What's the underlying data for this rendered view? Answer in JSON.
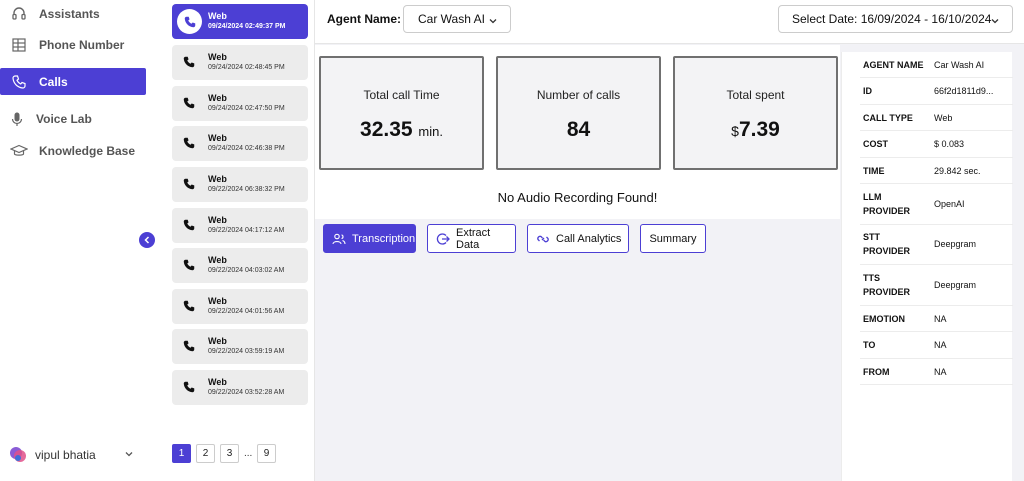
{
  "sidebar": {
    "items": [
      {
        "label": "Assistants",
        "icon": "headset-icon"
      },
      {
        "label": "Phone Number",
        "icon": "grid-icon"
      },
      {
        "label": "Calls",
        "icon": "phone-icon"
      },
      {
        "label": "Voice Lab",
        "icon": "microphone-icon"
      },
      {
        "label": "Knowledge Base",
        "icon": "graduation-cap-icon"
      }
    ],
    "user_name": "vipul bhatia"
  },
  "calls": [
    {
      "type": "Web",
      "time": "09/24/2024 02:49:37 PM"
    },
    {
      "type": "Web",
      "time": "09/24/2024 02:48:45 PM"
    },
    {
      "type": "Web",
      "time": "09/24/2024 02:47:50 PM"
    },
    {
      "type": "Web",
      "time": "09/24/2024 02:46:38 PM"
    },
    {
      "type": "Web",
      "time": "09/22/2024 06:38:32 PM"
    },
    {
      "type": "Web",
      "time": "09/22/2024 04:17:12 AM"
    },
    {
      "type": "Web",
      "time": "09/22/2024 04:03:02 AM"
    },
    {
      "type": "Web",
      "time": "09/22/2024 04:01:56 AM"
    },
    {
      "type": "Web",
      "time": "09/22/2024 03:59:19 AM"
    },
    {
      "type": "Web",
      "time": "09/22/2024 03:52:28 AM"
    }
  ],
  "pager": {
    "pages": [
      "1",
      "2",
      "3"
    ],
    "dots": "...",
    "last": "9"
  },
  "header": {
    "agent_label": "Agent Name:",
    "agent_value": "Car Wash AI",
    "date_value": "Select Date: 16/09/2024 - 16/10/2024"
  },
  "stats": {
    "total_time": {
      "label": "Total call Time",
      "value": "32.35",
      "unit": "min."
    },
    "num_calls": {
      "label": "Number of calls",
      "value": "84"
    },
    "total_spent": {
      "label": "Total spent",
      "currency": "$",
      "value": "7.39"
    }
  },
  "no_audio": "No Audio Recording Found!",
  "tabs": [
    "Transcription",
    "Extract Data",
    "Call Analytics",
    "Summary"
  ],
  "details": [
    {
      "key": "AGENT NAME",
      "value": "Car Wash AI"
    },
    {
      "key": "ID",
      "value": "66f2d1811d9..."
    },
    {
      "key": "CALL TYPE",
      "value": "Web"
    },
    {
      "key": "COST",
      "value": "$ 0.083"
    },
    {
      "key": "TIME",
      "value": "29.842 sec."
    },
    {
      "key": "LLM PROVIDER",
      "value": "OpenAI"
    },
    {
      "key": "STT PROVIDER",
      "value": "Deepgram"
    },
    {
      "key": "TTS PROVIDER",
      "value": "Deepgram"
    },
    {
      "key": "EMOTION",
      "value": "NA"
    },
    {
      "key": "TO",
      "value": "NA"
    },
    {
      "key": "FROM",
      "value": "NA"
    }
  ],
  "colors": {
    "accent": "#4c3fd4"
  }
}
